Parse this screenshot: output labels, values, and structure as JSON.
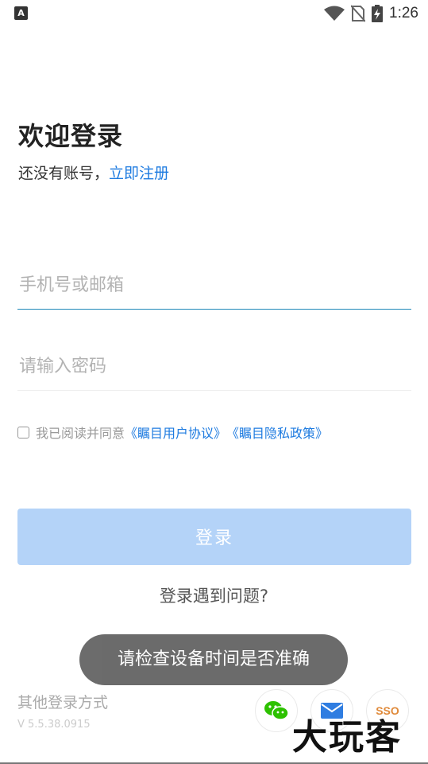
{
  "status_bar": {
    "time": "1:26",
    "app_icon_letter": "A"
  },
  "login": {
    "title": "欢迎登录",
    "subtitle_prefix": "还没有账号，",
    "register_link": "立即注册",
    "phone_placeholder": "手机号或邮箱",
    "phone_value": "",
    "password_placeholder": "请输入密码",
    "password_value": "",
    "agree_text": "我已阅读并同意",
    "user_agreement": "《瞩目用户协议》",
    "privacy_policy": "《瞩目隐私政策》",
    "login_button": "登录",
    "trouble_link": "登录遇到问题?",
    "other_login": "其他登录方式",
    "version": "V 5.5.38.0915"
  },
  "toast": {
    "message": "请检查设备时间是否准确"
  },
  "social": {
    "sso_label": "SSO"
  },
  "watermark": {
    "text": "大玩客"
  },
  "colors": {
    "link": "#1e7be0",
    "button_disabled": "#b4d3f8",
    "input_focus_line": "#1e88b8",
    "toast_bg": "#666666",
    "sso": "#e08a3a",
    "wechat": "#2dc100",
    "mail": "#2f7de1"
  }
}
